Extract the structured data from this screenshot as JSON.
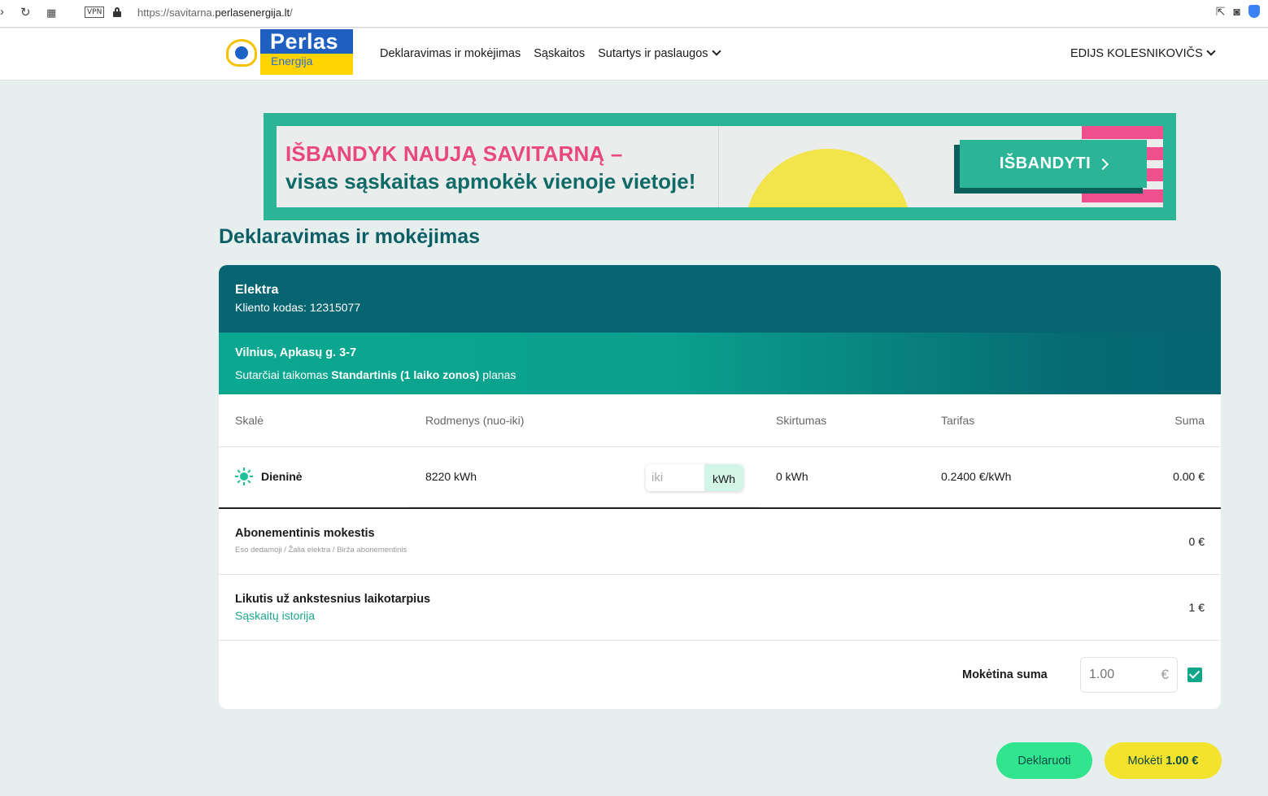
{
  "browser": {
    "url_prefix": "https://savitarna.",
    "url_domain": "perlasenergija.lt",
    "url_suffix": "/",
    "vpn_label": "VPN"
  },
  "header": {
    "logo_top": "Perlas",
    "logo_bottom": "Energija",
    "nav": [
      "Deklaravimas ir mokėjimas",
      "Sąskaitos",
      "Sutartys ir paslaugos"
    ],
    "user": "EDIJS KOLESNIKOVIČS"
  },
  "banner": {
    "line1": "IŠBANDYK NAUJĄ SAVITARNĄ –",
    "line2": "visas sąskaitas apmokėk vienoje vietoje!",
    "button": "IŠBANDYTI"
  },
  "page_title": "Deklaravimas ir mokėjimas",
  "card": {
    "title": "Elektra",
    "client_code": "Kliento kodas: 12315077",
    "address": "Vilnius, Apkasų g. 3-7",
    "plan_prefix": "Sutarčiai taikomas ",
    "plan_name": "Standartinis (1 laiko zonos)",
    "plan_suffix": " planas",
    "columns": [
      "Skalė",
      "Rodmenys (nuo-iki)",
      "Skirtumas",
      "Tarifas",
      "Suma"
    ],
    "row": {
      "scale": "Dieninė",
      "from": "8220 kWh",
      "to_placeholder": "iki",
      "to_unit": "kWh",
      "difference": "0 kWh",
      "tariff": "0.2400 €/kWh",
      "sum": "0.00 €"
    },
    "subscription": {
      "label": "Abonementinis mokestis",
      "note": "Eso dedamoji / Žalia elektra / Birža abonementinis",
      "amount": "0 €"
    },
    "balance": {
      "label": "Likutis už ankstesnius laikotarpius",
      "link": "Sąskaitų istorija",
      "amount": "1 €"
    },
    "payable": {
      "label": "Mokėtina suma",
      "value": "1.00",
      "currency": "€",
      "checked": true
    }
  },
  "actions": {
    "declare": "Deklaruoti",
    "pay_label": "Mokėti",
    "pay_amount": "1.00 €"
  },
  "colors": {
    "teal_dark": "#066571",
    "teal_accent": "#2bb596",
    "pink": "#e9477e",
    "yellow": "#f4e32c",
    "green_btn": "#31e58f"
  }
}
